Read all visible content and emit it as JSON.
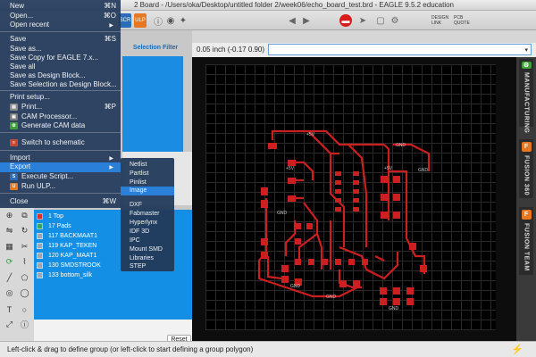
{
  "window": {
    "title": "2 Board - /Users/oka/Desktop/untitled folder 2/week06/echo_board_test.brd - EAGLE 9.5.2 education"
  },
  "toolbar": {
    "design_link": "DESIGN LINK",
    "pcb_quote": "PCB QUOTE",
    "scr": "SCR",
    "ulp": "ULP"
  },
  "coords": {
    "text": "0.05 inch (-0.17 0.90)"
  },
  "selection_filter": {
    "label": "Selection Filter"
  },
  "file_menu": {
    "items": [
      {
        "label": "New",
        "shortcut": "⌘N"
      },
      {
        "label": "Open...",
        "shortcut": "⌘O"
      },
      {
        "label": "Open recent",
        "arrow": "▶"
      },
      {
        "label": "Save",
        "shortcut": "⌘S"
      },
      {
        "label": "Save as..."
      },
      {
        "label": "Save Copy for EAGLE 7.x..."
      },
      {
        "label": "Save all"
      },
      {
        "label": "Save as Design Block..."
      },
      {
        "label": "Save Selection as Design Block..."
      },
      {
        "label": "Print setup..."
      },
      {
        "label": "Print...",
        "shortcut": "⌘P"
      },
      {
        "label": "CAM Processor..."
      },
      {
        "label": "Generate CAM data"
      },
      {
        "label": "Switch to schematic"
      },
      {
        "label": "Import",
        "arrow": "▶"
      },
      {
        "label": "Export",
        "arrow": "▶"
      },
      {
        "label": "Execute Script..."
      },
      {
        "label": "Run ULP..."
      },
      {
        "label": "Close",
        "shortcut": "⌘W"
      }
    ]
  },
  "export_submenu": {
    "items": [
      "Netlist",
      "Partlist",
      "Pinlist",
      "Image",
      "DXF",
      "Fabmaster",
      "Hyperlynx",
      "IDF 3D",
      "IPC",
      "Mount SMD",
      "Libraries",
      "STEP"
    ]
  },
  "layers": {
    "items": [
      {
        "name": "1 Top",
        "color": "#d23030"
      },
      {
        "name": "17 Pads",
        "color": "#38a06a"
      },
      {
        "name": "117 BACKMAAT1",
        "color": "#9aa9b8"
      },
      {
        "name": "119 KAP_TEKEN",
        "color": "#9aa9b8"
      },
      {
        "name": "120 KAP_MAAT1",
        "color": "#9aa9b8"
      },
      {
        "name": "130 SMDSTROOK",
        "color": "#9aa9b8"
      },
      {
        "name": "133 bottom_silk",
        "color": "#9aa9b8"
      }
    ]
  },
  "reset_label": "Reset",
  "side_tabs": [
    {
      "label": "MANUFACTURING",
      "icon": "gear-icon",
      "color": "#3aa335"
    },
    {
      "label": "FUSION 360",
      "icon": "fusion-icon",
      "color": "#e87722"
    },
    {
      "label": "FUSION TEAM",
      "icon": "team-icon",
      "color": "#e87722"
    }
  ],
  "board_labels": {
    "vcc": "+5V",
    "gnd": "GND"
  },
  "status": {
    "text": "Left-click & drag to define group (or left-click to start defining a group polygon)"
  },
  "colors": {
    "trace": "#cc1f1f",
    "accent": "#2a7fd8"
  }
}
